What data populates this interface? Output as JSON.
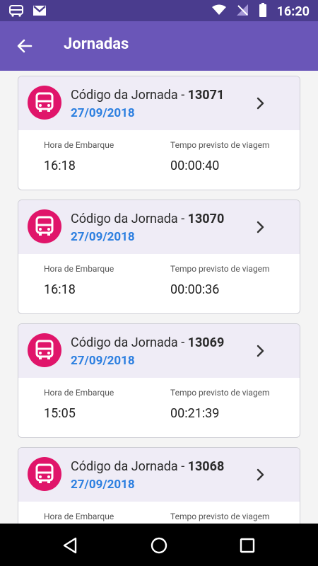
{
  "status": {
    "time": "16:20"
  },
  "appbar": {
    "title": "Jornadas"
  },
  "cards": [
    {
      "prefix": "Código da Jornada -",
      "code": "13071",
      "date": "27/09/2018",
      "board_label": "Hora de Embarque",
      "board_time": "16:18",
      "duration_label": "Tempo previsto de viagem",
      "duration": "00:00:40"
    },
    {
      "prefix": "Código da Jornada -",
      "code": "13070",
      "date": "27/09/2018",
      "board_label": "Hora de Embarque",
      "board_time": "16:18",
      "duration_label": "Tempo previsto de viagem",
      "duration": "00:00:36"
    },
    {
      "prefix": "Código da Jornada -",
      "code": "13069",
      "date": "27/09/2018",
      "board_label": "Hora de Embarque",
      "board_time": "15:05",
      "duration_label": "Tempo previsto de viagem",
      "duration": "00:21:39"
    },
    {
      "prefix": "Código da Jornada -",
      "code": "13068",
      "date": "27/09/2018",
      "board_label": "Hora de Embarque",
      "board_time": "",
      "duration_label": "Tempo previsto de viagem",
      "duration": ""
    }
  ],
  "colors": {
    "statusbar": "#4a3c8e",
    "appbar": "#6a56b8",
    "bus_icon_bg": "#e0156a",
    "date": "#2c7fe0",
    "card_header": "#efecf6"
  }
}
